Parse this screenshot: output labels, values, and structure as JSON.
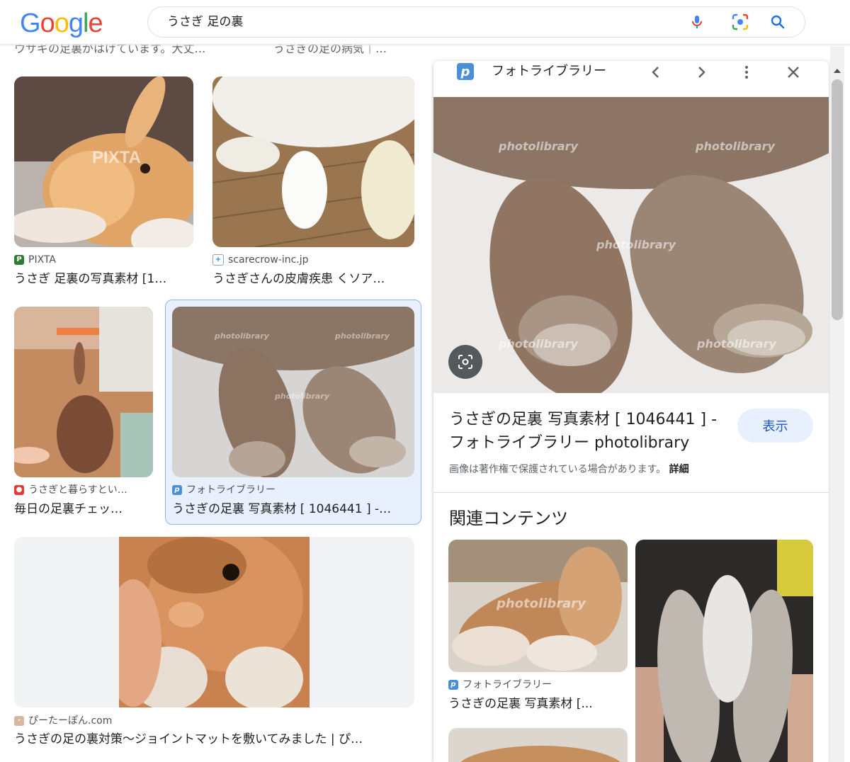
{
  "header": {
    "logo_letters": [
      {
        "ch": "G",
        "color": "#4285f4"
      },
      {
        "ch": "o",
        "color": "#ea4335"
      },
      {
        "ch": "o",
        "color": "#fbbc05"
      },
      {
        "ch": "g",
        "color": "#4285f4"
      },
      {
        "ch": "l",
        "color": "#34a853"
      },
      {
        "ch": "e",
        "color": "#ea4335"
      }
    ],
    "search_query": "うさぎ 足の裏",
    "icons": [
      "mic-icon",
      "camera-lens-icon",
      "search-icon"
    ]
  },
  "results": {
    "cut_titles": [
      "ウサギの足裏がはげています。大丈…",
      "うさぎの足の病気｜…"
    ],
    "items": [
      {
        "source": "PIXTA",
        "title": "うさぎ 足裏の写真素材 [1…"
      },
      {
        "source": "scarecrow-inc.jp",
        "title": "うさぎさんの皮膚疾患 くソア…"
      },
      {
        "source": "うさぎと暮らすとい…",
        "title": "毎日の足裏チェッ…"
      },
      {
        "source": "フォトライブラリー",
        "title": "うさぎの足裏 写真素材 [ 1046441 ] -…"
      },
      {
        "source": "ぴーたーぽん.com",
        "title": "うさぎの足の裏対策〜ジョイントマットを敷いてみました | ぴ…"
      }
    ]
  },
  "panel": {
    "source": "フォトライブラリー",
    "title_line1": "うさぎの足裏 写真素材 [ 1046441 ] -",
    "title_line2": "フォトライブラリー photolibrary",
    "view_button": "表示",
    "copyright": "画像は著作権で保護されている場合があります。",
    "details_link": "詳細",
    "related_heading": "関連コンテンツ",
    "related_items": [
      {
        "source": "フォトライブラリー",
        "title": "うさぎの足裏 写真素材 [..."
      }
    ],
    "watermark": "photolibrary"
  },
  "colors": {
    "accent_blue": "#1a73e8",
    "selected_bg": "#e8f0fe",
    "selected_border": "#8ab4f8"
  }
}
